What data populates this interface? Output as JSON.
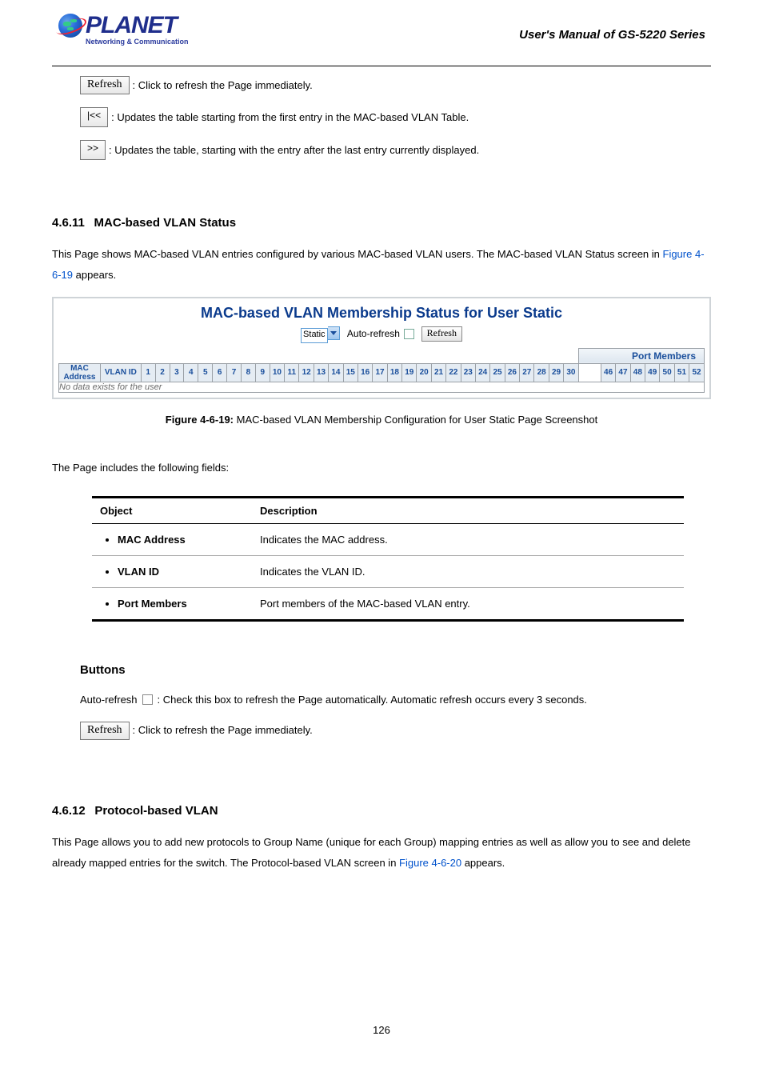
{
  "header": {
    "brand": "PLANET",
    "tagline": "Networking & Communication",
    "manual": "User's Manual of GS-5220 Series"
  },
  "btn": {
    "refresh": "Refresh",
    "first": "|<<",
    "next": ">>"
  },
  "line1": ": Click to refresh the Page immediately.",
  "line2": ": Updates the table starting from the first entry in the MAC-based VLAN Table.",
  "line3": ": Updates the table, starting with the entry after the last entry currently displayed.",
  "sec1": {
    "num": "4.6.11",
    "title": "MAC-based VLAN Status"
  },
  "para1a": "This Page shows MAC-based VLAN entries configured by various MAC-based VLAN users. The MAC-based VLAN Status screen in ",
  "para1link": "Figure 4-6-19",
  "para1b": " appears.",
  "shot": {
    "title": "MAC-based VLAN Membership Status for User Static",
    "user": "Static",
    "auto": "Auto-refresh",
    "refresh": "Refresh",
    "portmembers": "Port Members",
    "mac": "MAC Address",
    "vlan": "VLAN ID",
    "ports_left": [
      "1",
      "2",
      "3",
      "4",
      "5",
      "6",
      "7",
      "8",
      "9",
      "10",
      "11",
      "12",
      "13",
      "14",
      "15",
      "16",
      "17",
      "18",
      "19",
      "20",
      "21",
      "22",
      "23",
      "24",
      "25",
      "26",
      "27",
      "28",
      "29",
      "30"
    ],
    "ports_right": [
      "46",
      "47",
      "48",
      "49",
      "50",
      "51",
      "52"
    ],
    "nodata": "No data exists for the user"
  },
  "fig_caption_pre": "Figure 4-6-19:",
  "fig_caption": " MAC-based VLAN Membership Configuration for User Static Page Screenshot",
  "fields_intro": "The Page includes the following fields:",
  "fields_head": {
    "obj": "Object",
    "desc": "Description"
  },
  "fields": [
    {
      "name": "MAC Address",
      "desc": "Indicates the MAC address."
    },
    {
      "name": "VLAN ID",
      "desc": "Indicates the VLAN ID."
    },
    {
      "name": "Port Members",
      "desc": "Port members of the MAC-based VLAN entry."
    }
  ],
  "buttons_head": "Buttons",
  "auto_refresh_line_a": "Auto-refresh ",
  "auto_refresh_line_b": ": Check this box to refresh the Page automatically. Automatic refresh occurs every 3 seconds.",
  "refresh_line": ": Click to refresh the Page immediately.",
  "sec2": {
    "num": "4.6.12",
    "title": "Protocol-based VLAN"
  },
  "para2a": "This Page allows you to add new protocols to Group Name (unique for each Group) mapping entries as well as allow you to see and delete already mapped entries for the switch. The Protocol-based VLAN screen in ",
  "para2link": "Figure 4-6-20",
  "para2b": " appears.",
  "pagenum": "126"
}
